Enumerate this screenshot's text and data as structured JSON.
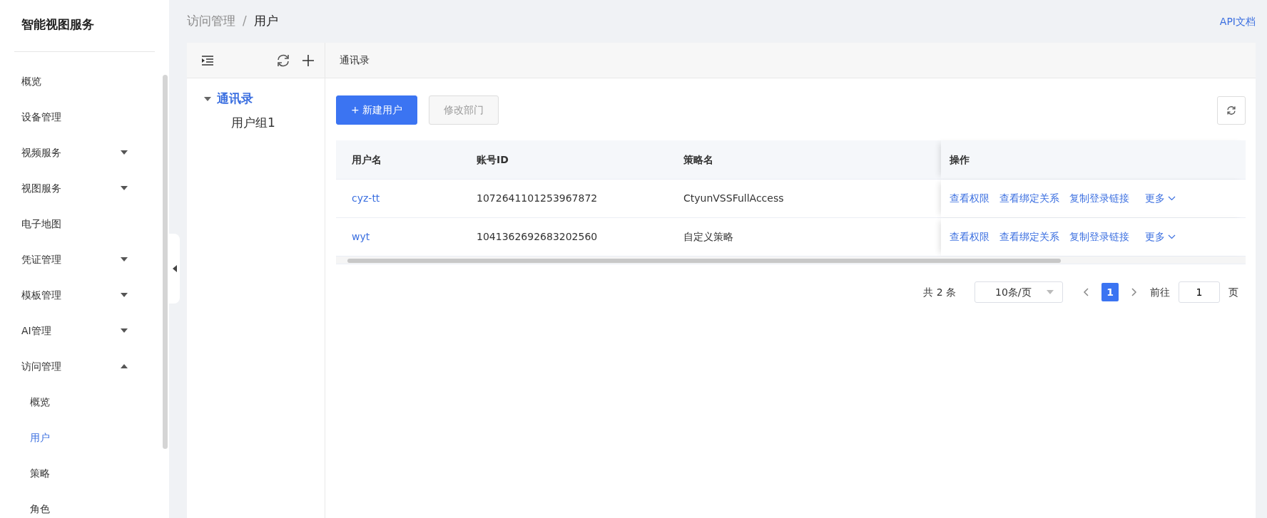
{
  "sidebar": {
    "title": "智能视图服务",
    "items": [
      {
        "label": "概览",
        "kind": "link",
        "selected": false
      },
      {
        "label": "设备管理",
        "kind": "link",
        "selected": false
      },
      {
        "label": "视频服务",
        "kind": "group",
        "expanded": false
      },
      {
        "label": "视图服务",
        "kind": "group",
        "expanded": false
      },
      {
        "label": "电子地图",
        "kind": "link",
        "selected": false
      },
      {
        "label": "凭证管理",
        "kind": "group",
        "expanded": false
      },
      {
        "label": "模板管理",
        "kind": "group",
        "expanded": false
      },
      {
        "label": "AI管理",
        "kind": "group",
        "expanded": false
      },
      {
        "label": "访问管理",
        "kind": "group",
        "expanded": true,
        "children": [
          {
            "label": "概览",
            "selected": false
          },
          {
            "label": "用户",
            "selected": true
          },
          {
            "label": "策略",
            "selected": false
          },
          {
            "label": "角色",
            "selected": false
          }
        ]
      }
    ]
  },
  "breadcrumb": [
    {
      "label": "访问管理"
    },
    {
      "label": "用户"
    }
  ],
  "breadcrumb_separator": "/",
  "api_doc_link": "API文档",
  "tree": {
    "nodes": [
      {
        "label": "通讯录",
        "expanded": true,
        "selected": true,
        "children": [
          {
            "label": "用户组1",
            "selected": false
          }
        ]
      }
    ]
  },
  "panel_title": "通讯录",
  "buttons": [
    {
      "label": "+ 新建用户",
      "kind": "primary",
      "disabled": false
    },
    {
      "label": "修改部门",
      "kind": "default",
      "disabled": true
    }
  ],
  "table": {
    "columns": [
      "用户名",
      "账号ID",
      "策略名",
      "操作"
    ],
    "rows": [
      {
        "user": "cyz-tt",
        "account_id": "1072641101253967872",
        "policy": "CtyunVSSFullAccess",
        "actions": [
          "查看权限",
          "查看绑定关系",
          "复制登录链接"
        ],
        "more": "更多"
      },
      {
        "user": "wyt",
        "account_id": "1041362692683202560",
        "policy": "自定义策略",
        "actions": [
          "查看权限",
          "查看绑定关系",
          "复制登录链接"
        ],
        "more": "更多"
      }
    ]
  },
  "pagination": {
    "total": "共 2 条",
    "page_size": "10条/页",
    "pages": [
      {
        "label": "1",
        "selected": true
      }
    ],
    "goto_label": "前往",
    "goto_value": "1",
    "goto_suffix": "页"
  }
}
